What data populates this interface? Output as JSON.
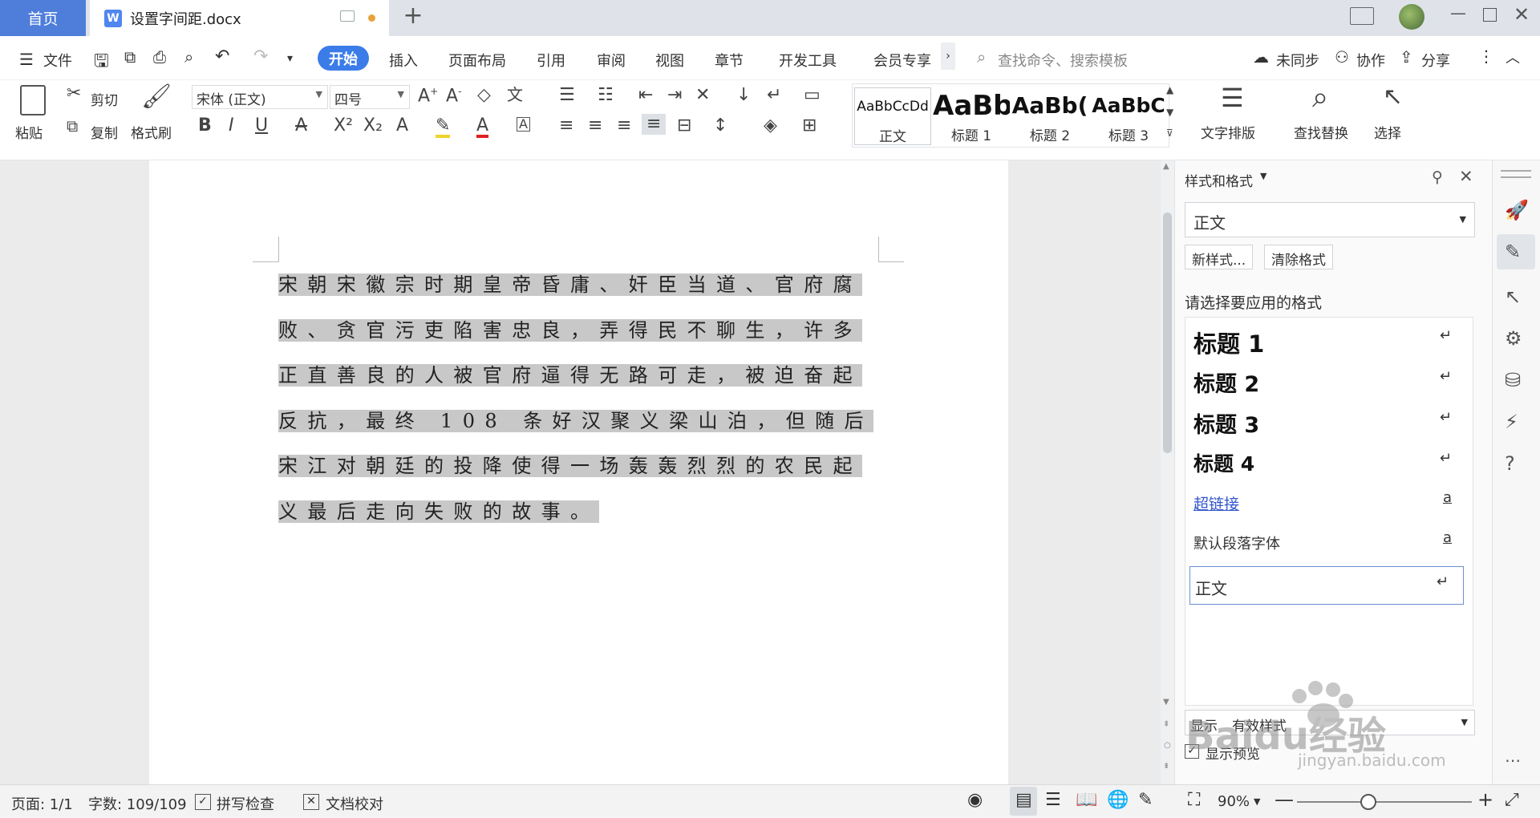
{
  "tabbar": {
    "home": "首页",
    "doc_title": "设置字间距.docx",
    "doc_icon": "W"
  },
  "ribbon_tabs": {
    "file": "文件",
    "start": "开始",
    "insert": "插入",
    "layout": "页面布局",
    "reference": "引用",
    "review": "审阅",
    "view": "视图",
    "chapter": "章节",
    "devtools": "开发工具",
    "member": "会员专享",
    "search_placeholder": "查找命令、搜索模板",
    "unsynced": "未同步",
    "collab": "协作",
    "share": "分享"
  },
  "ribbon": {
    "paste": "粘贴",
    "cut": "剪切",
    "copy": "复制",
    "format_painter": "格式刷",
    "font_name": "宋体 (正文)",
    "font_size": "四号",
    "styles": [
      {
        "preview": "AaBbCcDd",
        "name": "正文"
      },
      {
        "preview": "AaBb",
        "name": "标题 1"
      },
      {
        "preview": "AaBb(",
        "name": "标题 2"
      },
      {
        "preview": "AaBbC",
        "name": "标题 3"
      }
    ],
    "text_layout": "文字排版",
    "find_replace": "查找替换",
    "select": "选择"
  },
  "document": {
    "text": "宋朝宋徽宗时期皇帝昏庸、奸臣当道、官府腐败、贪官污吏陷害忠良，弄得民不聊生，许多正直善良的人被官府逼得无路可走，被迫奋起反抗，最终 108 条好汉聚义梁山泊，但随后宋江对朝廷的投降使得一场轰轰烈烈的农民起义最后走向失败的故事。"
  },
  "panel": {
    "title": "样式和格式",
    "current_style": "正文",
    "new_style": "新样式...",
    "clear_format": "清除格式",
    "prompt": "请选择要应用的格式",
    "items": [
      {
        "label": "标题  1",
        "mark": "↵"
      },
      {
        "label": "标题  2",
        "mark": "↵"
      },
      {
        "label": "标题  3",
        "mark": "↵"
      },
      {
        "label": "标题  4",
        "mark": "↵"
      },
      {
        "label": "超链接",
        "mark": "a"
      },
      {
        "label": "默认段落字体",
        "mark": "a"
      },
      {
        "label": "正文",
        "mark": "↵"
      }
    ],
    "show_label": "显示",
    "show_value": "有效样式",
    "show_preview": "显示预览"
  },
  "statusbar": {
    "page": "页面: 1/1",
    "words": "字数: 109/109",
    "spell": "拼写检查",
    "proofread": "文档校对",
    "zoom": "90%"
  },
  "watermark": {
    "brand": "Baidu经验",
    "url": "jingyan.baidu.com"
  },
  "colors": {
    "accent": "#3b7ce9",
    "home_tab": "#4e7dda",
    "selection": "#c8c8c8",
    "link": "#3355cc"
  }
}
